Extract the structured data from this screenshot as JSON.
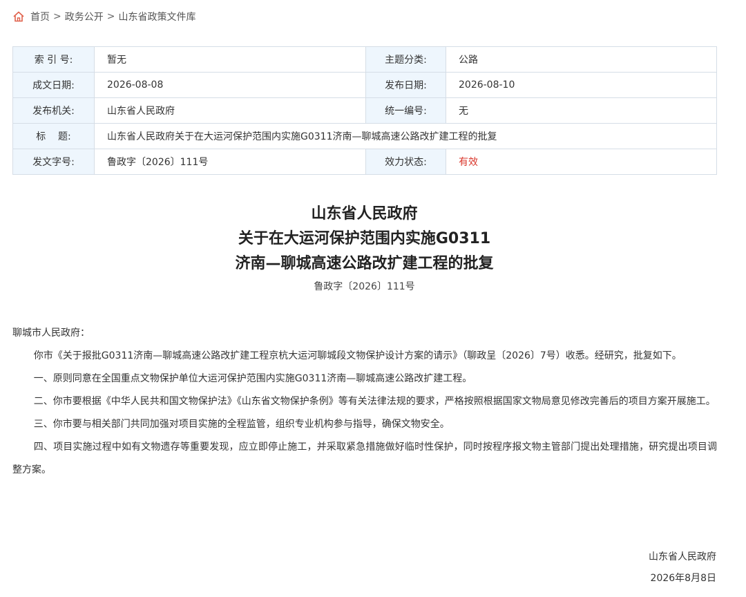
{
  "breadcrumb": {
    "items": [
      "首页",
      "政务公开",
      "山东省政策文件库"
    ],
    "separator": ">"
  },
  "meta": {
    "index_label": "索 引 号:",
    "index_value": "暂无",
    "topic_label": "主题分类:",
    "topic_value": "公路",
    "written_date_label": "成文日期:",
    "written_date_value": "2026-08-08",
    "publish_date_label": "发布日期:",
    "publish_date_value": "2026-08-10",
    "issuer_label": "发布机关:",
    "issuer_value": "山东省人民政府",
    "serial_label": "统一编号:",
    "serial_value": "无",
    "title_label": "标    题:",
    "title_value": "山东省人民政府关于在大运河保护范围内实施G0311济南—聊城高速公路改扩建工程的批复",
    "doc_no_label": "发文字号:",
    "doc_no_value": "鲁政字〔2026〕111号",
    "status_label": "效力状态:",
    "status_value": "有效",
    "status_color": "#d9362b"
  },
  "document": {
    "title_line1": "山东省人民政府",
    "title_line2": "关于在大运河保护范围内实施G0311",
    "title_line3": "济南—聊城高速公路改扩建工程的批复",
    "doc_number": "鲁政字〔2026〕111号",
    "salutation": "聊城市人民政府：",
    "paragraphs": [
      "你市《关于报批G0311济南—聊城高速公路改扩建工程京杭大运河聊城段文物保护设计方案的请示》（聊政呈〔2026〕7号）收悉。经研究，批复如下。",
      "一、原则同意在全国重点文物保护单位大运河保护范围内实施G0311济南—聊城高速公路改扩建工程。",
      "二、你市要根据《中华人民共和国文物保护法》《山东省文物保护条例》等有关法律法规的要求，严格按照根据国家文物局意见修改完善后的项目方案开展施工。",
      "三、你市要与相关部门共同加强对项目实施的全程监管，组织专业机构参与指导，确保文物安全。",
      "四、项目实施过程中如有文物遗存等重要发现，应立即停止施工，并采取紧急措施做好临时性保护，同时按程序报文物主管部门提出处理措施，研究提出项目调整方案。"
    ],
    "signature_org": "山东省人民政府",
    "signature_date": "2026年8月8日"
  }
}
